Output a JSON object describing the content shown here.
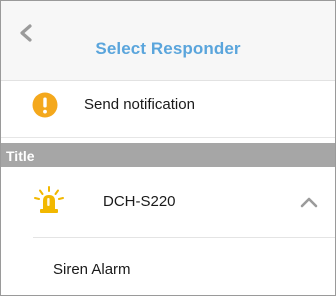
{
  "header": {
    "back_icon": "chevron-left-icon",
    "title": "Select Responder",
    "title_color": "#5aa5dc"
  },
  "notification": {
    "icon": "warning-icon",
    "icon_color": "#f4a81c",
    "label": "Send notification"
  },
  "section": {
    "label": "Title",
    "background": "#a6a6a6"
  },
  "device": {
    "icon": "siren-icon",
    "icon_color": "#f2b800",
    "name": "DCH-S220",
    "expand_icon": "chevron-up-icon",
    "expanded": true
  },
  "device_options": [
    {
      "label": "Siren Alarm"
    }
  ]
}
